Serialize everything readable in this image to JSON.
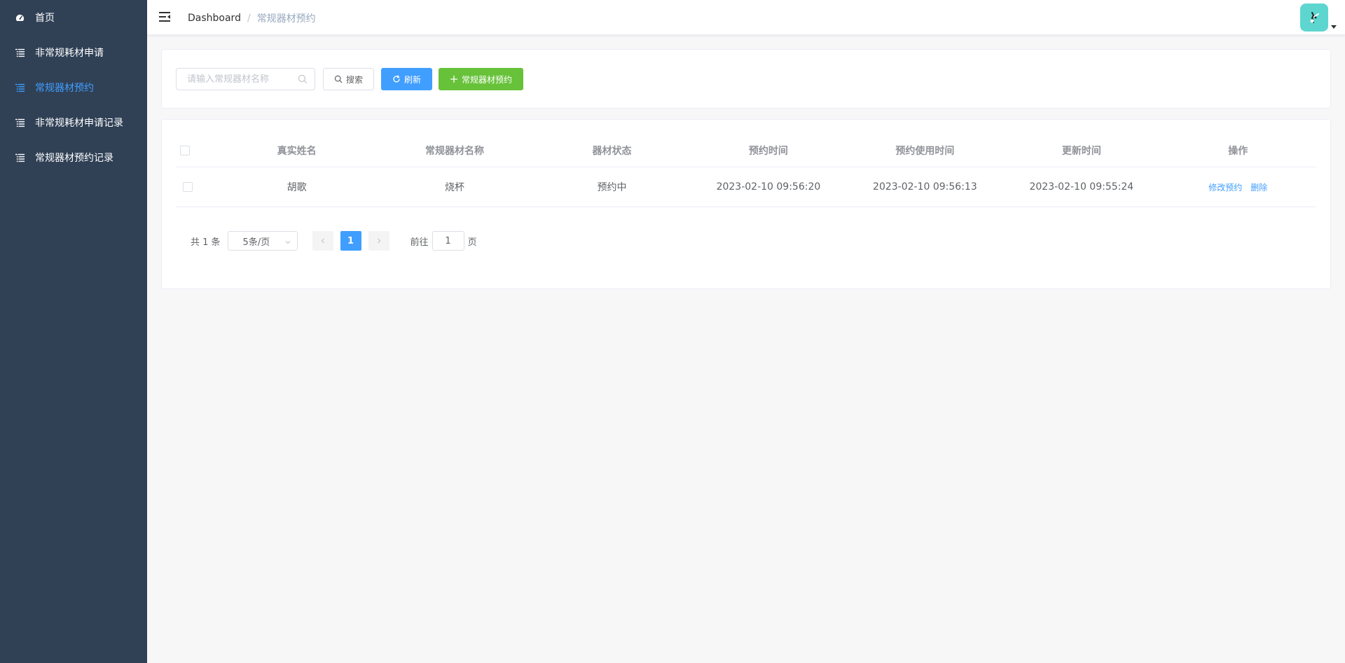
{
  "sidebar": {
    "items": [
      {
        "label": "首页",
        "icon": "dashboard-icon",
        "active": false
      },
      {
        "label": "非常规耗材申请",
        "icon": "list-icon",
        "active": false
      },
      {
        "label": "常规器材预约",
        "icon": "list-icon",
        "active": true
      },
      {
        "label": "非常规耗材申请记录",
        "icon": "list-icon",
        "active": false
      },
      {
        "label": "常规器材预约记录",
        "icon": "list-icon",
        "active": false
      }
    ]
  },
  "navbar": {
    "breadcrumb": {
      "root": "Dashboard",
      "separator": "/",
      "current": "常规器材预约"
    }
  },
  "filter": {
    "search_placeholder": "请输入常规器材名称",
    "search_label": "搜索",
    "refresh_label": "刷新",
    "add_label": "常规器材预约"
  },
  "table": {
    "headers": [
      "真实姓名",
      "常规器材名称",
      "器材状态",
      "预约时间",
      "预约使用时间",
      "更新时间",
      "操作"
    ],
    "rows": [
      {
        "name": "胡歌",
        "equipment": "烧杯",
        "status": "预约中",
        "reserve_time": "2023-02-10 09:56:20",
        "use_time": "2023-02-10 09:56:13",
        "update_time": "2023-02-10 09:55:24",
        "edit_label": "修改预约",
        "delete_label": "删除"
      }
    ]
  },
  "pagination": {
    "total": "共 1 条",
    "page_size": "5条/页",
    "current_page": "1",
    "goto_prefix": "前往",
    "goto_value": "1",
    "goto_suffix": "页"
  },
  "colors": {
    "sidebar_bg": "#304156",
    "primary": "#409eff",
    "success": "#67c23a",
    "avatar_bg": "#5cd6cf"
  }
}
